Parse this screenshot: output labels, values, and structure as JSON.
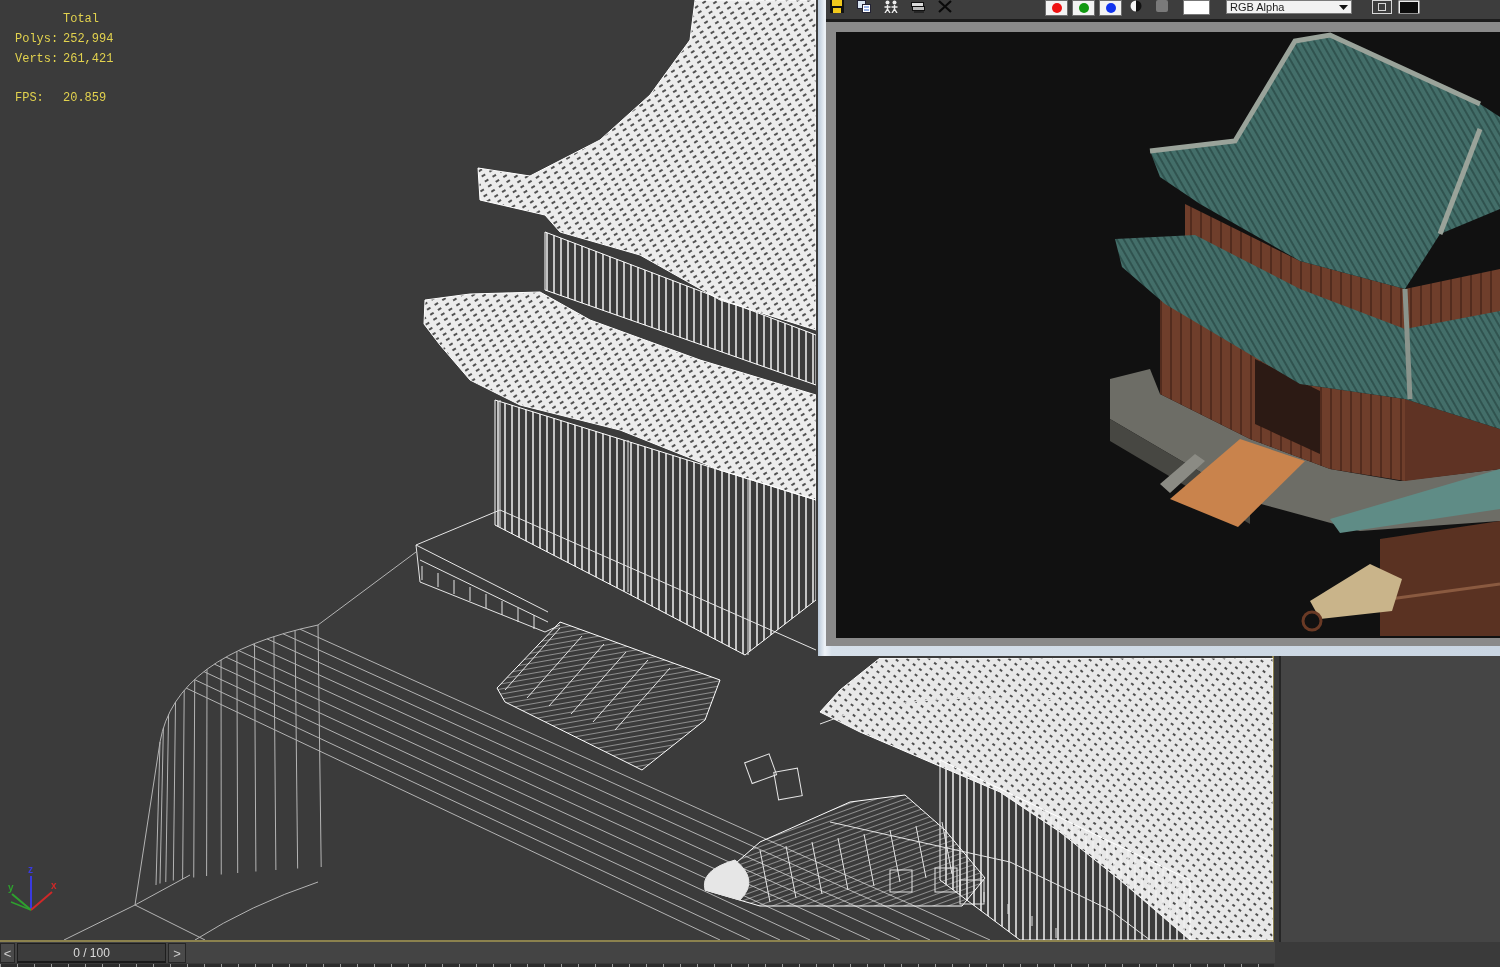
{
  "viewport": {
    "stats": {
      "heading": "Total",
      "counts": [
        {
          "label": "Polys:",
          "value": "252,994"
        },
        {
          "label": "Verts:",
          "value": "261,421"
        }
      ],
      "fps": {
        "label": "FPS:",
        "value": "20.859"
      }
    },
    "axes": [
      {
        "label": "z",
        "color": "#3a3ae0"
      },
      {
        "label": "y",
        "color": "#2ea02e"
      },
      {
        "label": "x",
        "color": "#d02828"
      }
    ]
  },
  "render_window": {
    "toolbar": {
      "channels": [
        {
          "color": "#ee1111"
        },
        {
          "color": "#119911"
        },
        {
          "color": "#1133ee"
        }
      ],
      "display_channel": "RGB Alpha"
    }
  },
  "timeline": {
    "previous": "<",
    "frame": "0 / 100",
    "next": ">",
    "level": 0
  }
}
